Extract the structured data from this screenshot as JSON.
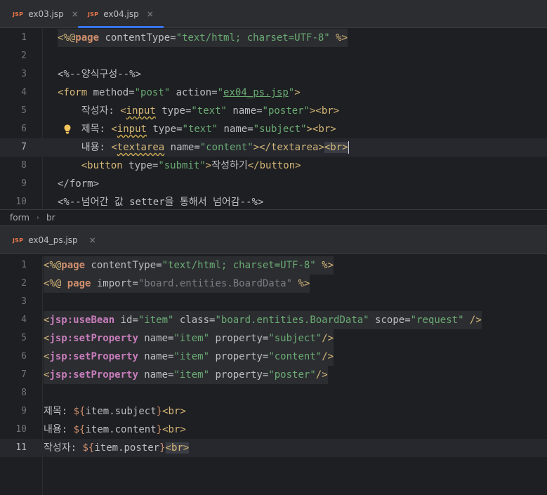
{
  "top_tabs": [
    {
      "badge": "JSP",
      "label": "ex03.jsp",
      "close": "×"
    },
    {
      "badge": "JSP",
      "label": "ex04.jsp",
      "close": "×"
    }
  ],
  "top_editor": {
    "line_numbers": [
      "1",
      "2",
      "3",
      "4",
      "5",
      "6",
      "7",
      "8",
      "9",
      "10"
    ],
    "lines": {
      "l1a": "<%@",
      "l1b": "page",
      "l1c": " contentType=",
      "l1d": "\"text/html; charset=UTF-8\"",
      "l1e": " %>",
      "l3": "<%--양식구성--%>",
      "l4a": "<form",
      "l4b": " method=",
      "l4c": "\"post\"",
      "l4d": " action=",
      "l4e": "\"",
      "l4f": "ex04_ps.jsp",
      "l4g": "\"",
      "l4h": ">",
      "l5a": "    작성자: ",
      "l5b": "<",
      "l5c": "input",
      "l5d": " type=",
      "l5e": "\"text\"",
      "l5f": " name=",
      "l5g": "\"poster\"",
      "l5h": "><br>",
      "l6a": "    제목: ",
      "l6b": "<",
      "l6c": "input",
      "l6d": " type=",
      "l6e": "\"text\"",
      "l6f": " name=",
      "l6g": "\"subject\"",
      "l6h": "><br>",
      "l7a": "    내용: ",
      "l7b": "<",
      "l7c": "textarea",
      "l7d": " name=",
      "l7e": "\"content\"",
      "l7f": "></textarea>",
      "l7g": "<br>",
      "l8a": "    ",
      "l8b": "<button",
      "l8c": " type=",
      "l8d": "\"submit\"",
      "l8e": ">",
      "l8f": "작성하기",
      "l8g": "</button>",
      "l9": "</form>",
      "l10": "<%--넘어간 값 setter을 통해서 넘어감--%>"
    }
  },
  "breadcrumb": {
    "item1": "form",
    "sep": "›",
    "item2": "br"
  },
  "bottom_tabs": [
    {
      "badge": "JSP",
      "label": "ex04_ps.jsp",
      "close": "×"
    }
  ],
  "bottom_editor": {
    "line_numbers": [
      "1",
      "2",
      "3",
      "4",
      "5",
      "6",
      "7",
      "8",
      "9",
      "10",
      "11"
    ],
    "lines": {
      "b1a": "<%@",
      "b1b": "page",
      "b1c": " contentType=",
      "b1d": "\"text/html; charset=UTF-8\"",
      "b1e": " %>",
      "b2a": "<%@ ",
      "b2b": "page",
      "b2c": " import=",
      "b2d": "\"board.entities.BoardData\"",
      "b2e": " %>",
      "b4a": "<",
      "b4b": "jsp:useBean",
      "b4c": " id=",
      "b4d": "\"item\"",
      "b4e": " class=",
      "b4f": "\"board.entities.BoardData\"",
      "b4g": " scope=",
      "b4h": "\"request\"",
      "b4i": " />",
      "b5a": "<",
      "b5b": "jsp:setProperty",
      "b5c": " name=",
      "b5d": "\"item\"",
      "b5e": " property=",
      "b5f": "\"subject\"",
      "b5g": "/>",
      "b6a": "<",
      "b6b": "jsp:setProperty",
      "b6c": " name=",
      "b6d": "\"item\"",
      "b6e": " property=",
      "b6f": "\"content\"",
      "b6g": "/>",
      "b7a": "<",
      "b7b": "jsp:setProperty",
      "b7c": " name=",
      "b7d": "\"item\"",
      "b7e": " property=",
      "b7f": "\"poster\"",
      "b7g": "/>",
      "b9a": "제목: ",
      "b9b": "${",
      "b9c": "item.subject",
      "b9d": "}",
      "b9e": "<br>",
      "b10a": "내용: ",
      "b10b": "${",
      "b10c": "item.content",
      "b10d": "}",
      "b10e": "<br>",
      "b11a": "작성자: ",
      "b11b": "${",
      "b11c": "item.poster",
      "b11d": "}",
      "b11e": "<br>"
    }
  },
  "colors": {
    "accent": "#3574f0",
    "background": "#1e1f22",
    "tag": "#d5b778",
    "string": "#6aab73",
    "keyword": "#cf8e6d",
    "jsp_tag": "#c77dbb"
  },
  "icons": {
    "file_badge": "jsp-file-icon",
    "hint": "lightbulb-icon",
    "close": "close-icon"
  }
}
